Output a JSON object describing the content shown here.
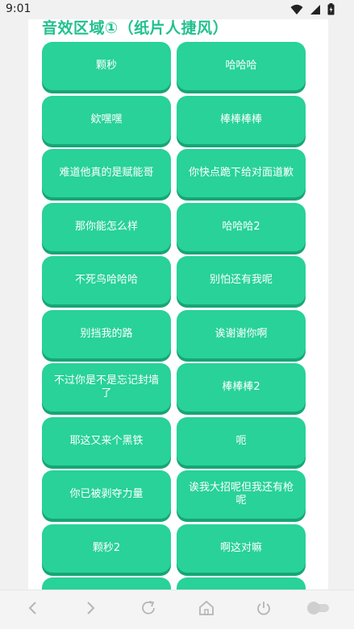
{
  "status_bar": {
    "time": "9:01",
    "icons": [
      "wifi-icon",
      "signal-icon",
      "battery-icon"
    ]
  },
  "section": {
    "title": "音效区域①（纸片人捷风）"
  },
  "sound_buttons": [
    "颗秒",
    "哈哈哈",
    "欸嘿嘿",
    "棒棒棒棒",
    "难道他真的是赋能哥",
    "你快点跪下给对面道歉",
    "那你能怎么样",
    "哈哈哈2",
    "不死鸟哈哈哈",
    "别怕还有我呢",
    "别挡我的路",
    "诶谢谢你啊",
    "不过你是不是忘记封墙了",
    "棒棒棒2",
    "耶这又来个黑铁",
    "呃",
    "你已被剥夺力量",
    "诶我大招呢但我还有枪呢",
    "颗秒2",
    "啊这对嘛",
    "",
    ""
  ],
  "colors": {
    "button": "#28d298",
    "button_shadow": "#17a577",
    "title": "#22c08e",
    "background": "#f1f1f1"
  },
  "bottom_nav": {
    "icons": [
      "back-icon",
      "forward-icon",
      "reload-icon",
      "home-icon",
      "power-icon",
      "toggle-icon"
    ]
  }
}
